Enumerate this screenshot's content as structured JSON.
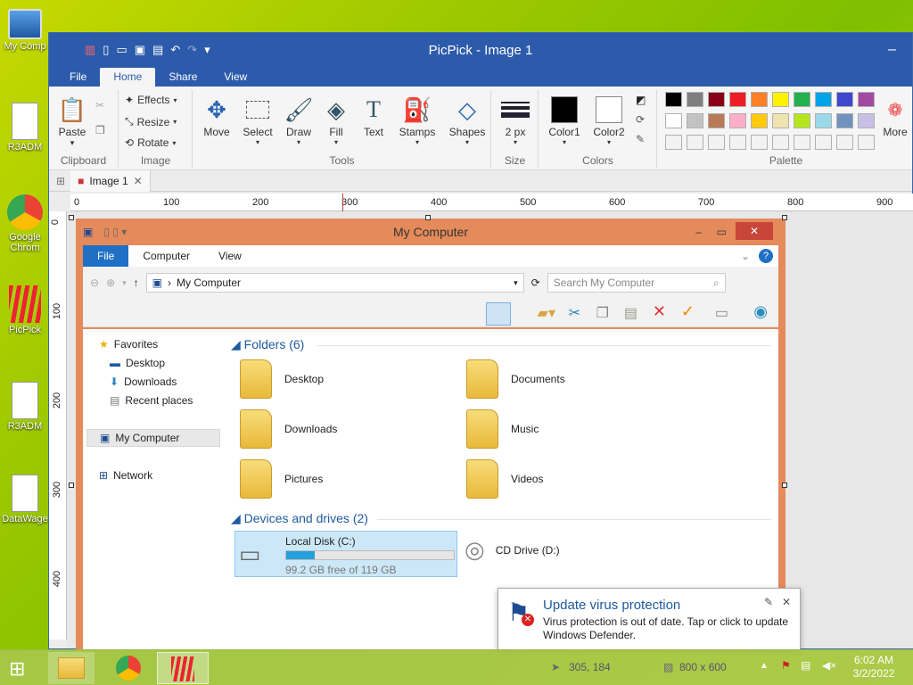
{
  "desktop": {
    "icons": [
      "My Comp",
      "R3ADM",
      "Google Chrom",
      "PicPick",
      "R3ADM",
      "DataWage"
    ]
  },
  "app": {
    "title": "PicPick - Image 1",
    "menu": [
      "File",
      "Home",
      "Share",
      "View"
    ],
    "ribbon": {
      "clipboard": {
        "paste": "Paste",
        "label": "Clipboard"
      },
      "image": {
        "effects": "Effects",
        "resize": "Resize",
        "rotate": "Rotate",
        "label": "Image"
      },
      "tools": {
        "move": "Move",
        "select": "Select",
        "draw": "Draw",
        "fill": "Fill",
        "text": "Text",
        "stamps": "Stamps",
        "shapes": "Shapes",
        "label": "Tools"
      },
      "size": {
        "value": "2 px",
        "label": "Size"
      },
      "colors": {
        "color1": "Color1",
        "color2": "Color2",
        "label": "Colors",
        "color1_hex": "#000000",
        "color2_hex": "#ffffff"
      },
      "palette": {
        "label": "Palette",
        "more": "More",
        "row1": [
          "#000000",
          "#7f7f7f",
          "#880015",
          "#ed1c24",
          "#ff7f27",
          "#fff200",
          "#22b14c",
          "#00a2e8",
          "#3f48cc",
          "#a349a4"
        ],
        "row2": [
          "#ffffff",
          "#c3c3c3",
          "#b97a57",
          "#ffaec9",
          "#ffc90e",
          "#efe4b0",
          "#b5e61d",
          "#99d9ea",
          "#7092be",
          "#c8bfe7"
        ]
      }
    },
    "tab": {
      "label": "Image 1"
    },
    "ruler_h": [
      "0",
      "100",
      "200",
      "300",
      "400",
      "500",
      "600",
      "700",
      "800",
      "900"
    ],
    "ruler_v": [
      "0",
      "100",
      "200",
      "300",
      "400"
    ]
  },
  "explorer": {
    "title": "My Computer",
    "tabs": [
      "File",
      "Computer",
      "View"
    ],
    "address": "My Computer",
    "search_placeholder": "Search My Computer",
    "nav": {
      "favorites": "Favorites",
      "desktop": "Desktop",
      "downloads": "Downloads",
      "recent": "Recent places",
      "mycomputer": "My Computer",
      "network": "Network"
    },
    "folders_header": "Folders (6)",
    "folders": [
      "Desktop",
      "Documents",
      "Downloads",
      "Music",
      "Pictures",
      "Videos"
    ],
    "devices_header": "Devices and drives (2)",
    "local_disk": {
      "name": "Local Disk (C:)",
      "free": "99.2 GB free of 119 GB",
      "used_fraction": 0.17
    },
    "cd_drive": "CD Drive (D:)"
  },
  "toast": {
    "title": "Update virus protection",
    "body": "Virus protection is out of date. Tap or click to update Windows Defender."
  },
  "statusbar": {
    "cursor": "305, 184",
    "image_size": "800 x 600"
  },
  "tray": {
    "time": "6:02 AM",
    "date": "3/2/2022"
  }
}
